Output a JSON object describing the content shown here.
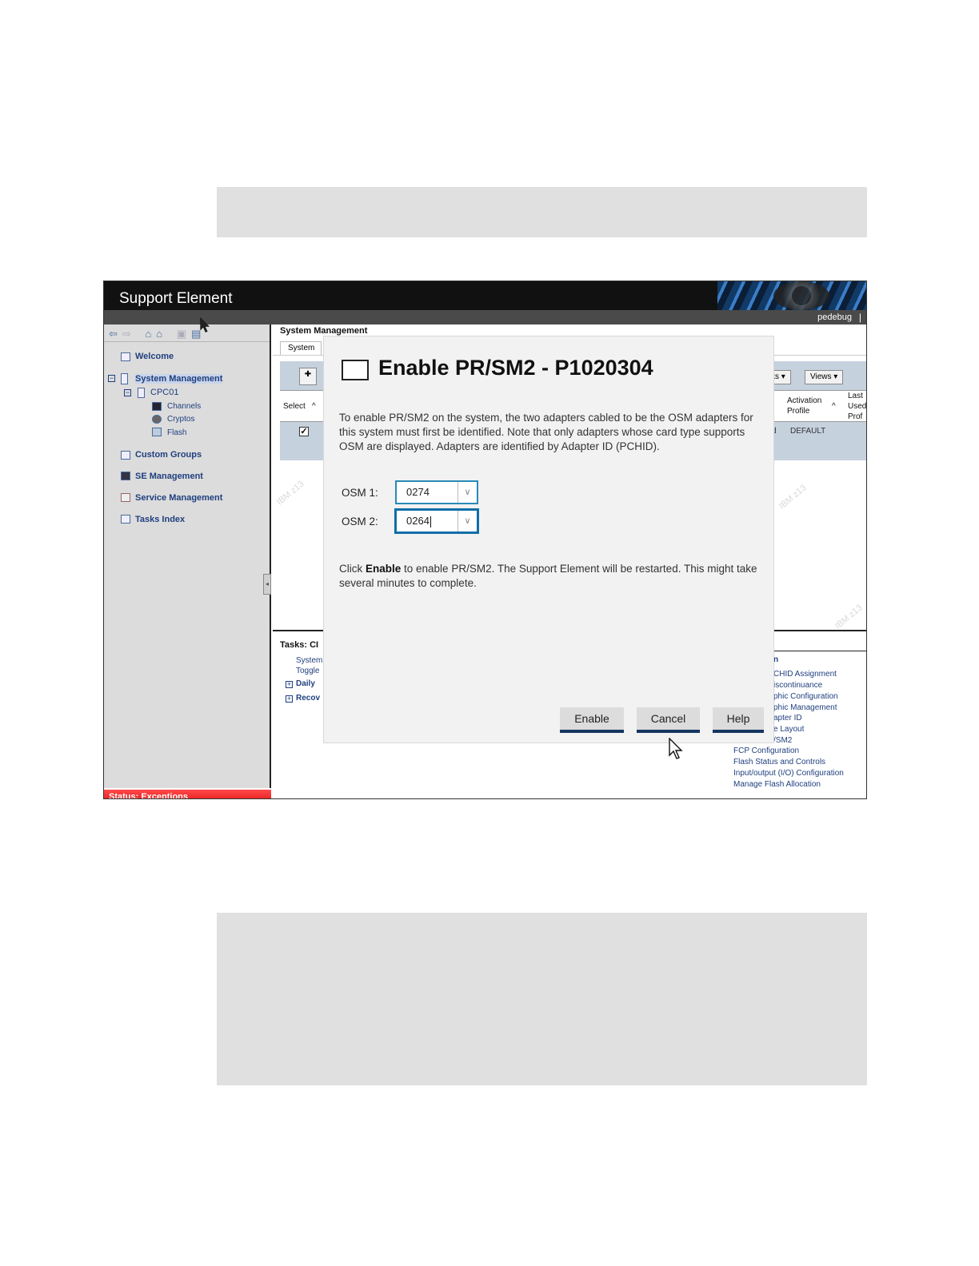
{
  "app": {
    "title": "Support Element",
    "user": "pedebug",
    "user_separator": "|"
  },
  "nav": {
    "toolbar_icons": [
      "back-arrow-icon",
      "forward-arrow-icon",
      "home-icon",
      "home-refresh-icon",
      "window-icon",
      "tree-view-icon"
    ],
    "items": [
      {
        "label": "Welcome",
        "icon": "welcome-icon"
      },
      {
        "label": "System Management",
        "icon": "server-icon"
      },
      {
        "label": "CPC01",
        "icon": "server-icon"
      },
      {
        "label": "Channels",
        "icon": "channels-icon"
      },
      {
        "label": "Cryptos",
        "icon": "crypto-icon"
      },
      {
        "label": "Flash",
        "icon": "flash-icon"
      },
      {
        "label": "Custom Groups",
        "icon": "groups-icon"
      },
      {
        "label": "SE Management",
        "icon": "computer-icon"
      },
      {
        "label": "Service Management",
        "icon": "tools-icon"
      },
      {
        "label": "Tasks Index",
        "icon": "list-icon"
      }
    ],
    "status": "Status: Exceptions"
  },
  "main": {
    "title": "System Management",
    "tab": "System",
    "table": {
      "headers": {
        "select": "Select",
        "activation_profile": "Activation Profile",
        "last_used": "Last Used Prof"
      },
      "row": {
        "checked": true,
        "profile": "DEFAULT",
        "partial_cell": "d"
      },
      "toolbar": {
        "tasks_partial": "ks",
        "views": "Views"
      }
    },
    "tasks": {
      "title": "Tasks: CI",
      "left_links": [
        "System",
        "Toggle"
      ],
      "left_groups": [
        "Daily",
        "Recov"
      ],
      "right_links": [
        "n",
        "CHID Assignment",
        "iscontinuance",
        "phic Configuration",
        "phic Management",
        "apter ID",
        "e Layout",
        "/SM2",
        "FCP Configuration",
        "Flash Status and Controls",
        "Input/output (I/O) Configuration",
        "Manage Flash Allocation"
      ]
    },
    "watermark": "IBM z13"
  },
  "dialog": {
    "title": "Enable PR/SM2 - P1020304",
    "description": "To enable PR/SM2 on the system, the two adapters cabled to be the OSM adapters for this system must first be identified. Note that only adapters whose card type supports OSM are displayed. Adapters are identified by Adapter ID (PCHID).",
    "osm1": {
      "label": "OSM 1:",
      "value": "0274"
    },
    "osm2": {
      "label": "OSM 2:",
      "value": "0264"
    },
    "note_prefix": "Click ",
    "note_bold": "Enable",
    "note_suffix": " to enable PR/SM2. The Support Element will be restarted. This might take several minutes to complete.",
    "buttons": {
      "enable": "Enable",
      "cancel": "Cancel",
      "help": "Help"
    }
  }
}
